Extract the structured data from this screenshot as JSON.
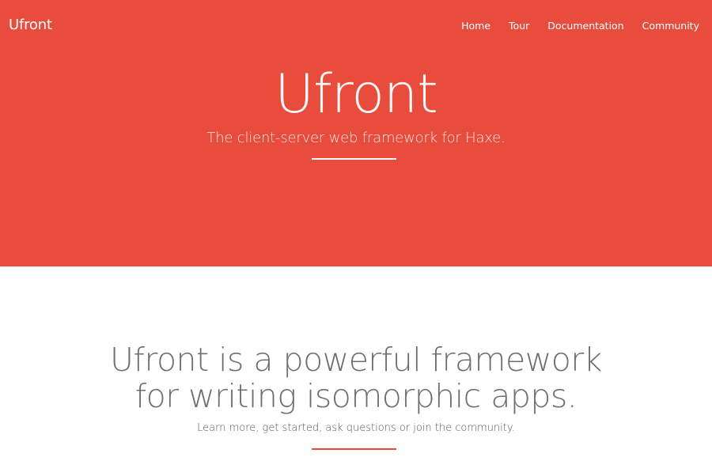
{
  "brand": {
    "name": "Ufront"
  },
  "nav": {
    "items": [
      {
        "label": "Home"
      },
      {
        "label": "Tour"
      },
      {
        "label": "Documentation"
      },
      {
        "label": "Community"
      }
    ]
  },
  "hero": {
    "title": "Ufront",
    "subtitle": "The client-server web framework for Haxe."
  },
  "about": {
    "title_line1": "Ufront is a powerful framework",
    "title_line2": "for writing isomorphic apps.",
    "subtitle": "Learn more, get started, ask questions or join the community."
  },
  "colors": {
    "accent": "#e84c3d",
    "background": "#ffffff"
  }
}
